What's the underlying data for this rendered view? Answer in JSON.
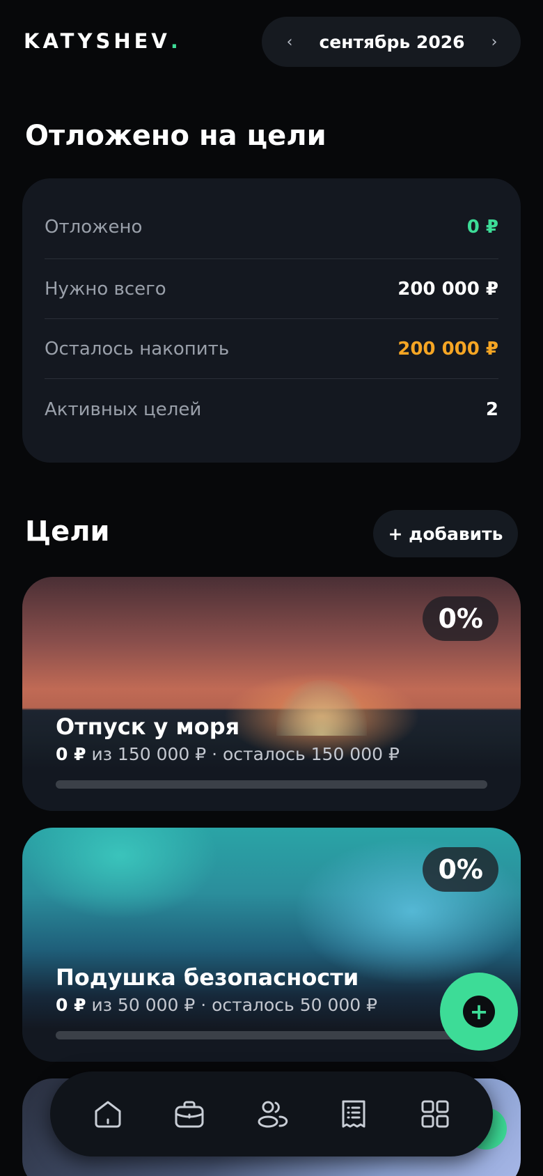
{
  "header": {
    "logo": "KATYSHEV",
    "logo_dot": ".",
    "month": "сентябрь 2026",
    "prev_icon": "chevron-left-icon",
    "next_icon": "chevron-right-icon",
    "prev_glyph": "‹",
    "next_glyph": "›"
  },
  "summary": {
    "title": "Отложено на цели",
    "rows": [
      {
        "label": "Отложено",
        "value": "0 ₽"
      },
      {
        "label": "Нужно всего",
        "value": "200 000 ₽"
      },
      {
        "label": "Осталось накопить",
        "value": "200 000 ₽"
      },
      {
        "label": "Активных целей",
        "value": "2"
      }
    ]
  },
  "goals_section": {
    "title": "Цели",
    "add_label": "+ добавить"
  },
  "goals": [
    {
      "title": "Отпуск у моря",
      "saved": "0 ₽",
      "rest": " из 150 000 ₽ · осталось 150 000 ₽",
      "percent_label": "0%",
      "progress": 0
    },
    {
      "title": "Подушка безопасности",
      "saved": "0 ₽",
      "rest": " из 50 000 ₽ · осталось 50 000 ₽",
      "percent_label": "0%",
      "progress": 0
    }
  ],
  "fab": {
    "glyph": "+",
    "icon": "plus-icon"
  },
  "tabbar": {
    "items": [
      {
        "icon": "home-icon"
      },
      {
        "icon": "briefcase-icon"
      },
      {
        "icon": "users-icon"
      },
      {
        "icon": "receipt-list-icon"
      },
      {
        "icon": "grid-icon"
      }
    ]
  },
  "colors": {
    "accent": "#3ddc97",
    "warning": "#f5a524",
    "card": "#141820",
    "background": "#07080a"
  }
}
